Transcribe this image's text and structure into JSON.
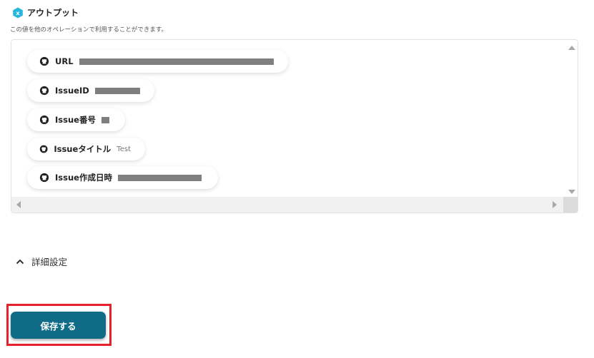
{
  "header": {
    "icon": "hexagon-x-icon",
    "icon_glyph": "x",
    "icon_color": "#29b6dd",
    "title": "アウトプット",
    "description": "この値を他のオペレーションで利用することができます。"
  },
  "outputs": [
    {
      "label": "URL",
      "icon": "github-icon",
      "value": "",
      "redacted": true
    },
    {
      "label": "IssueID",
      "icon": "github-icon",
      "value": "",
      "redacted": true
    },
    {
      "label": "Issue番号",
      "icon": "github-icon",
      "value": "",
      "redacted": true
    },
    {
      "label": "Issueタイトル",
      "icon": "github-icon",
      "value": "Test",
      "redacted": false
    },
    {
      "label": "Issue作成日時",
      "icon": "github-icon",
      "value": "",
      "redacted": true
    }
  ],
  "advanced": {
    "label": "詳細設定",
    "icon": "chevron-up-icon"
  },
  "actions": {
    "save_label": "保存する",
    "save_color": "#0f6b86",
    "highlight_color": "#e8222c"
  }
}
